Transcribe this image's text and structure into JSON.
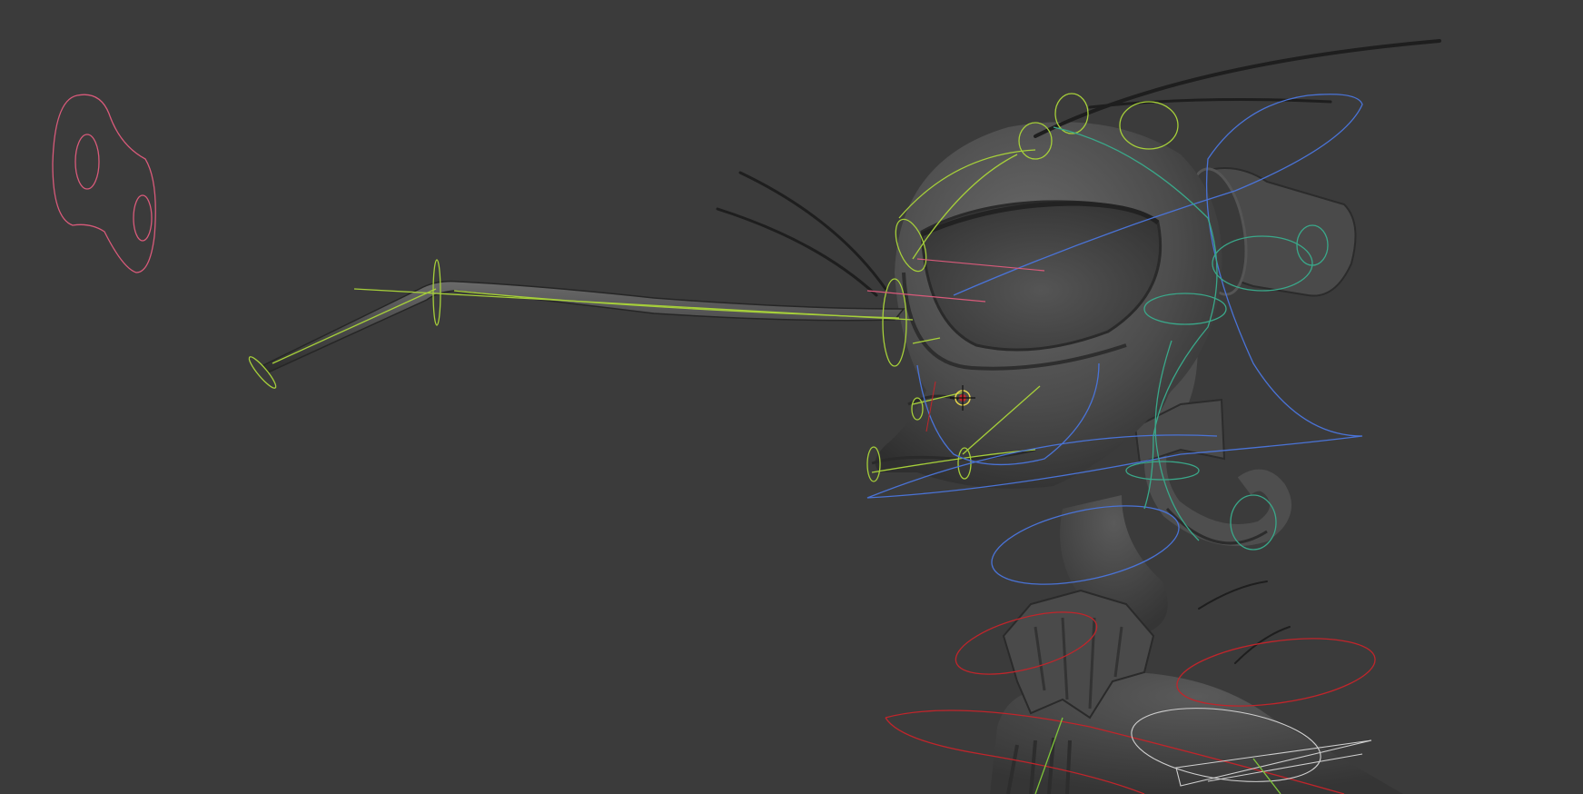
{
  "viewport": {
    "background_color": "#3b3b3b",
    "camera": "perspective"
  },
  "colors": {
    "mesh_fill": "#4a4a4a",
    "mesh_highlight": "#5e5e5e",
    "mesh_shadow": "#2a2a2a",
    "control_green": "#a6cf3a",
    "control_blue": "#4a73d6",
    "control_teal": "#3aa88a",
    "control_red": "#c0252b",
    "control_pink": "#d85a7a",
    "control_white": "#d8d8d8"
  },
  "scene": {
    "character": "rigged-character-head",
    "selected_control": "jaw-pivot-control"
  }
}
